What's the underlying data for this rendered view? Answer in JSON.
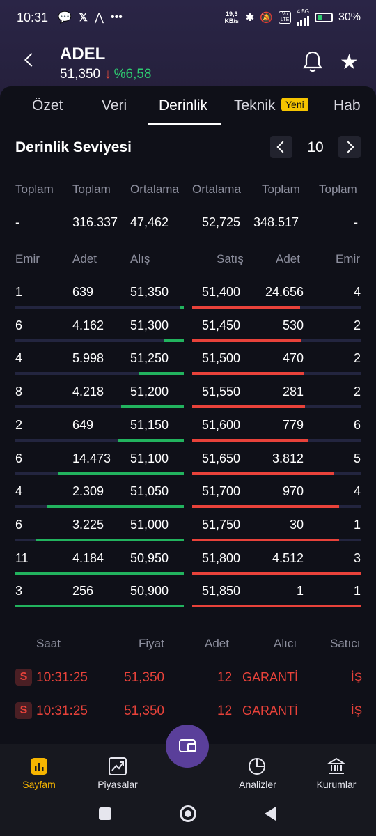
{
  "status": {
    "time": "10:31",
    "net_speed": "19,3 KB/s",
    "battery": "30%",
    "lte": "Vo LTE",
    "signal": "4.5G"
  },
  "stock": {
    "symbol": "ADEL",
    "price": "51,350",
    "change": "%6,58"
  },
  "tabs": [
    "Özet",
    "Veri",
    "Derinlik",
    "Teknik",
    "Hab"
  ],
  "tab_badge": "Yeni",
  "section": {
    "title": "Derinlik Seviyesi",
    "level": "10"
  },
  "summary_headers": [
    "Toplam",
    "Toplam",
    "Ortalama",
    "Ortalama",
    "Toplam",
    "Toplam"
  ],
  "summary_values": [
    "-",
    "316.337",
    "47,462",
    "52,725",
    "348.517",
    "-"
  ],
  "depth_headers": [
    "Emir",
    "Adet",
    "Alış",
    "Satış",
    "Adet",
    "Emir"
  ],
  "depth_rows": [
    {
      "bid_orders": "1",
      "bid_qty": "639",
      "bid": "51,350",
      "ask": "51,400",
      "ask_qty": "24.656",
      "ask_orders": "4",
      "bid_fill": 0.02,
      "ask_fill": 0.64
    },
    {
      "bid_orders": "6",
      "bid_qty": "4.162",
      "bid": "51,300",
      "ask": "51,450",
      "ask_qty": "530",
      "ask_orders": "2",
      "bid_fill": 0.12,
      "ask_fill": 0.65
    },
    {
      "bid_orders": "4",
      "bid_qty": "5.998",
      "bid": "51,250",
      "ask": "51,500",
      "ask_qty": "470",
      "ask_orders": "2",
      "bid_fill": 0.27,
      "ask_fill": 0.66
    },
    {
      "bid_orders": "8",
      "bid_qty": "4.218",
      "bid": "51,200",
      "ask": "51,550",
      "ask_qty": "281",
      "ask_orders": "2",
      "bid_fill": 0.37,
      "ask_fill": 0.67
    },
    {
      "bid_orders": "2",
      "bid_qty": "649",
      "bid": "51,150",
      "ask": "51,600",
      "ask_qty": "779",
      "ask_orders": "6",
      "bid_fill": 0.39,
      "ask_fill": 0.69
    },
    {
      "bid_orders": "6",
      "bid_qty": "14.473",
      "bid": "51,100",
      "ask": "51,650",
      "ask_qty": "3.812",
      "ask_orders": "5",
      "bid_fill": 0.75,
      "ask_fill": 0.84
    },
    {
      "bid_orders": "4",
      "bid_qty": "2.309",
      "bid": "51,050",
      "ask": "51,700",
      "ask_qty": "970",
      "ask_orders": "4",
      "bid_fill": 0.81,
      "ask_fill": 0.87
    },
    {
      "bid_orders": "6",
      "bid_qty": "3.225",
      "bid": "51,000",
      "ask": "51,750",
      "ask_qty": "30",
      "ask_orders": "1",
      "bid_fill": 0.88,
      "ask_fill": 0.87
    },
    {
      "bid_orders": "11",
      "bid_qty": "4.184",
      "bid": "50,950",
      "ask": "51,800",
      "ask_qty": "4.512",
      "ask_orders": "3",
      "bid_fill": 1.0,
      "ask_fill": 1.0
    },
    {
      "bid_orders": "3",
      "bid_qty": "256",
      "bid": "50,900",
      "ask": "51,850",
      "ask_qty": "1",
      "ask_orders": "1",
      "bid_fill": 1.0,
      "ask_fill": 1.0
    }
  ],
  "trade_headers": [
    "Saat",
    "Fiyat",
    "Adet",
    "Alıcı",
    "Satıcı"
  ],
  "trades": [
    {
      "side": "S",
      "time": "10:31:25",
      "price": "51,350",
      "qty": "12",
      "buyer": "GARANTİ",
      "seller": "İŞ"
    },
    {
      "side": "S",
      "time": "10:31:25",
      "price": "51,350",
      "qty": "12",
      "buyer": "GARANTİ",
      "seller": "İŞ"
    }
  ],
  "nav": [
    "Sayfam",
    "Piyasalar",
    "Analizler",
    "Kurumlar"
  ],
  "colors": {
    "bid": "#22b35e",
    "ask": "#e8423a",
    "accent": "#f5b400",
    "fab": "#5a3f9a"
  }
}
